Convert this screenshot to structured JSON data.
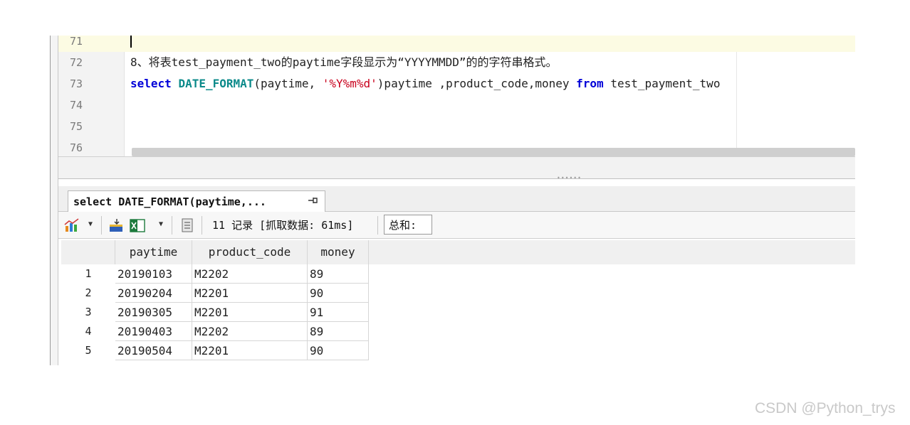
{
  "editor": {
    "lines": [
      {
        "num": "71",
        "text": ""
      },
      {
        "num": "72",
        "text": "8、将表test_payment_two的paytime字段显示为“YYYYMMDD”的的字符串格式。"
      },
      {
        "num": "73",
        "kw1": "select",
        "fn": "DATE_FORMAT",
        "p1": "(paytime, ",
        "str": "'%Y%m%d'",
        "p2": ")paytime ,product_code,money ",
        "kw2": "from",
        "p3": " test_payment_two"
      },
      {
        "num": "74",
        "text": ""
      },
      {
        "num": "75",
        "text": ""
      },
      {
        "num": "76",
        "text": ""
      }
    ]
  },
  "result_tab": {
    "label": "select DATE_FORMAT(paytime,...",
    "pin_icon": "pin-icon"
  },
  "toolbar": {
    "icons": [
      "chart-icon",
      "import-icon",
      "excel-icon",
      "notes-icon"
    ],
    "status": "11 记录 [抓取数据: 61ms]",
    "sum_label": "总和:"
  },
  "grid": {
    "columns": [
      "paytime",
      "product_code",
      "money"
    ],
    "rows": [
      {
        "n": "1",
        "paytime": "20190103",
        "product_code": "M2202",
        "money": "89"
      },
      {
        "n": "2",
        "paytime": "20190204",
        "product_code": "M2201",
        "money": "90"
      },
      {
        "n": "3",
        "paytime": "20190305",
        "product_code": "M2201",
        "money": "91"
      },
      {
        "n": "4",
        "paytime": "20190403",
        "product_code": "M2202",
        "money": "89"
      },
      {
        "n": "5",
        "paytime": "20190504",
        "product_code": "M2201",
        "money": "90"
      }
    ]
  },
  "watermark": "CSDN @Python_trys"
}
